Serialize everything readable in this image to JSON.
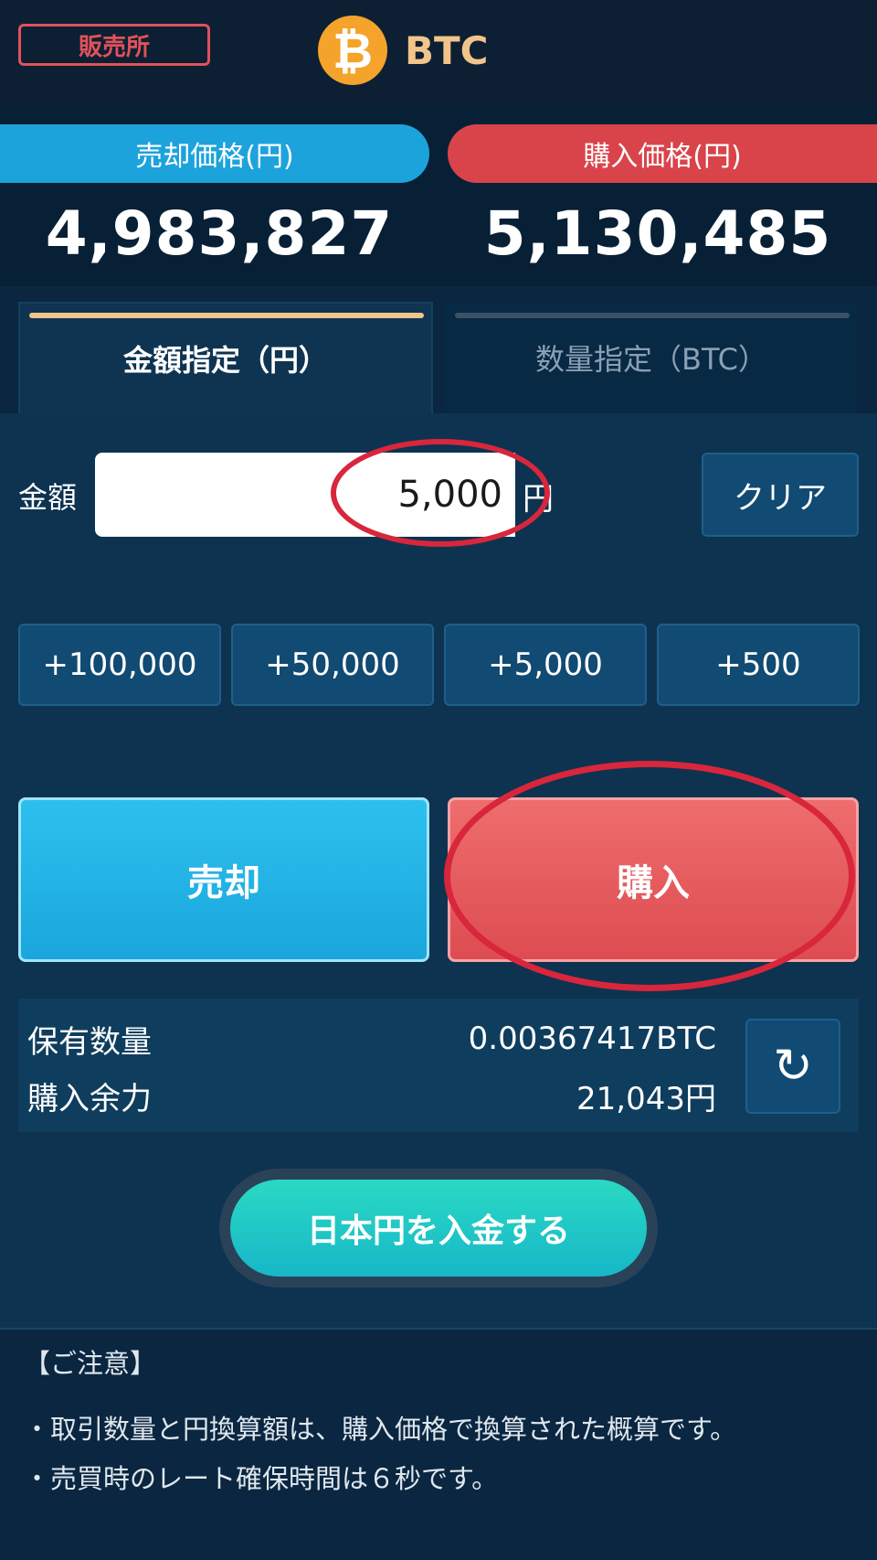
{
  "header": {
    "badge_label": "販売所",
    "coin_symbol": "₿",
    "coin_name": "BTC"
  },
  "prices": {
    "sell_label": "売却価格(円)",
    "buy_label": "購入価格(円)",
    "sell_price": "4,983,827",
    "buy_price": "5,130,485"
  },
  "tabs": [
    {
      "label": "金額指定（円）",
      "active": true
    },
    {
      "label": "数量指定（BTC）",
      "active": false
    }
  ],
  "amount": {
    "label": "金額",
    "value": "5,000",
    "unit": "円",
    "clear_label": "クリア"
  },
  "increments": [
    "+100,000",
    "+50,000",
    "+5,000",
    "+500"
  ],
  "actions": {
    "sell_label": "売却",
    "buy_label": "購入"
  },
  "holdings": {
    "quantity_label": "保有数量",
    "quantity_value": "0.00367417BTC",
    "power_label": "購入余力",
    "power_value": "21,043円",
    "refresh_icon": "↻"
  },
  "deposit": {
    "label": "日本円を入金する"
  },
  "notes": {
    "title": "【ご注意】",
    "items": [
      "・取引数量と円換算額は、購入価格で換算された概算です。",
      "・売買時のレート確保時間は６秒です。"
    ]
  },
  "colors": {
    "background": "#0a2640",
    "sell": "#1da3dc",
    "buy": "#d9444b",
    "accent": "#f2c48a",
    "deposit": "#2ad9c2",
    "highlight": "#d8263c"
  }
}
